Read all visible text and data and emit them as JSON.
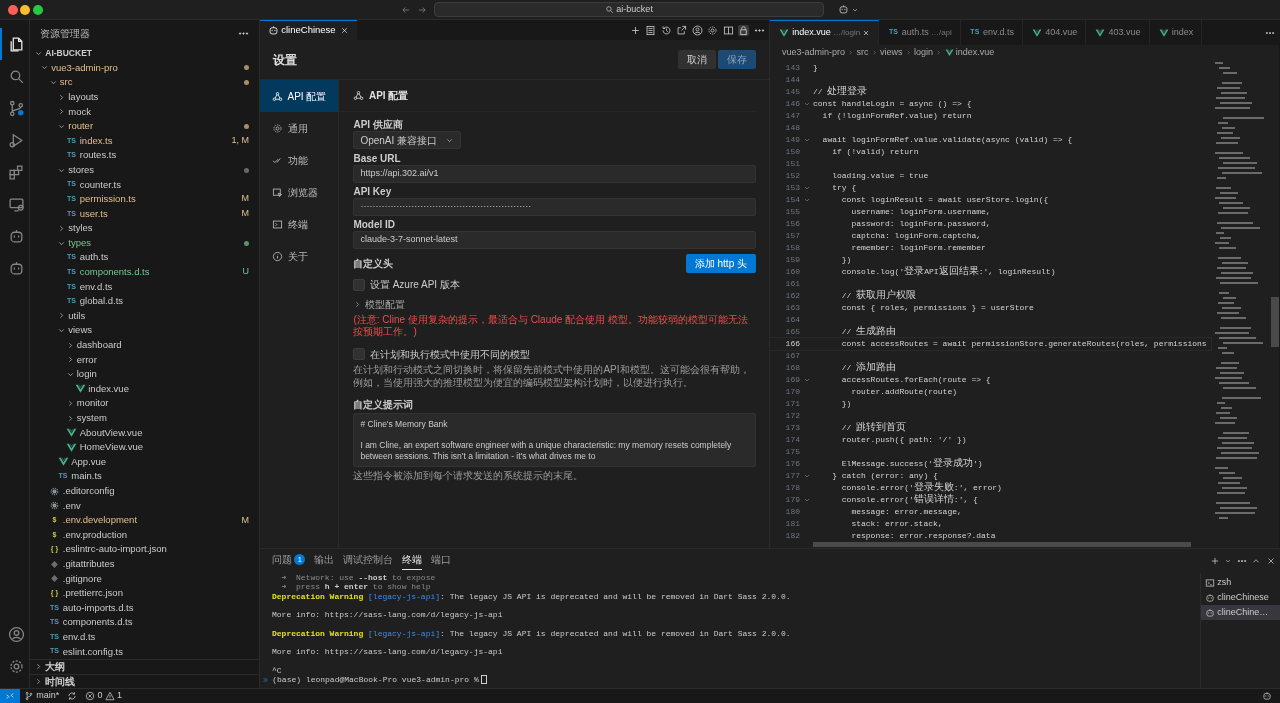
{
  "title_bar": {
    "search": "ai-bucket"
  },
  "activity_bar": [
    {
      "kind": "files",
      "selected": true
    },
    {
      "kind": "search",
      "selected": false
    },
    {
      "kind": "source-control",
      "selected": false
    },
    {
      "kind": "run",
      "selected": false
    },
    {
      "kind": "extensions",
      "selected": false
    },
    {
      "kind": "remote",
      "selected": false
    },
    {
      "kind": "robot",
      "selected": false
    },
    {
      "kind": "robot",
      "selected": false
    }
  ],
  "activity_bottom": [
    {
      "kind": "account"
    },
    {
      "kind": "gear"
    }
  ],
  "explorer": {
    "title": "资源管理器",
    "root": "AI-BUCKET",
    "tree": [
      {
        "label": "vue3-admin-pro",
        "kind": "folder",
        "expanded": true,
        "modified": true,
        "untracked": false,
        "dot": true,
        "children": [
          {
            "label": "src",
            "kind": "folder",
            "expanded": true,
            "modified": true,
            "untracked": false,
            "dot": true,
            "children": [
              {
                "label": "layouts",
                "kind": "folder",
                "expanded": false,
                "modified": false,
                "untracked": false,
                "dot": false
              },
              {
                "label": "mock",
                "kind": "folder",
                "expanded": false,
                "modified": false,
                "untracked": false,
                "dot": false
              },
              {
                "label": "router",
                "kind": "folder",
                "expanded": true,
                "modified": true,
                "untracked": false,
                "dot": true,
                "children": [
                  {
                    "label": "index.ts",
                    "kind": "ts",
                    "icon_text": "TS",
                    "modified": true,
                    "untracked": false,
                    "badge": "1, M"
                  },
                  {
                    "label": "routes.ts",
                    "kind": "ts",
                    "icon_text": "TS",
                    "modified": false,
                    "untracked": false
                  }
                ]
              },
              {
                "label": "stores",
                "kind": "folder",
                "expanded": true,
                "modified": false,
                "untracked": false,
                "dot": true,
                "children": [
                  {
                    "label": "counter.ts",
                    "kind": "ts",
                    "icon_text": "TS",
                    "modified": false,
                    "untracked": false
                  },
                  {
                    "label": "permission.ts",
                    "kind": "ts",
                    "icon_text": "TS",
                    "modified": true,
                    "untracked": false,
                    "badge": "M"
                  },
                  {
                    "label": "user.ts",
                    "kind": "ts",
                    "icon_text": "TS",
                    "modified": true,
                    "untracked": false,
                    "badge": "M"
                  }
                ]
              },
              {
                "label": "styles",
                "kind": "folder",
                "expanded": false,
                "modified": false,
                "untracked": false,
                "dot": false
              },
              {
                "label": "types",
                "kind": "folder",
                "expanded": true,
                "modified": false,
                "untracked": true,
                "dot": true,
                "children": [
                  {
                    "label": "auth.ts",
                    "kind": "ts",
                    "icon_text": "TS",
                    "modified": false,
                    "untracked": false
                  },
                  {
                    "label": "components.d.ts",
                    "kind": "ts",
                    "icon_text": "TS",
                    "modified": false,
                    "untracked": true,
                    "badge": "U"
                  },
                  {
                    "label": "env.d.ts",
                    "kind": "ts",
                    "icon_text": "TS",
                    "modified": false,
                    "untracked": false
                  },
                  {
                    "label": "global.d.ts",
                    "kind": "ts",
                    "icon_text": "TS",
                    "modified": false,
                    "untracked": false
                  }
                ]
              },
              {
                "label": "utils",
                "kind": "folder",
                "expanded": false,
                "modified": false,
                "untracked": false,
                "dot": false
              },
              {
                "label": "views",
                "kind": "folder",
                "expanded": true,
                "modified": false,
                "untracked": false,
                "dot": false,
                "children": [
                  {
                    "label": "dashboard",
                    "kind": "folder",
                    "expanded": false,
                    "modified": false,
                    "untracked": false,
                    "dot": false
                  },
                  {
                    "label": "error",
                    "kind": "folder",
                    "expanded": false,
                    "modified": false,
                    "untracked": false,
                    "dot": false
                  },
                  {
                    "label": "login",
                    "kind": "folder",
                    "expanded": true,
                    "modified": false,
                    "untracked": false,
                    "dot": false,
                    "children": [
                      {
                        "label": "index.vue",
                        "kind": "vue",
                        "modified": false,
                        "untracked": false
                      }
                    ]
                  },
                  {
                    "label": "monitor",
                    "kind": "folder",
                    "expanded": false,
                    "modified": false,
                    "untracked": false,
                    "dot": false
                  },
                  {
                    "label": "system",
                    "kind": "folder",
                    "expanded": false,
                    "modified": false,
                    "untracked": false,
                    "dot": false
                  },
                  {
                    "label": "AboutView.vue",
                    "kind": "vue",
                    "modified": false,
                    "untracked": false
                  },
                  {
                    "label": "HomeView.vue",
                    "kind": "vue",
                    "modified": false,
                    "untracked": false
                  }
                ]
              },
              {
                "label": "App.vue",
                "kind": "vue",
                "modified": false,
                "untracked": false
              },
              {
                "label": "main.ts",
                "kind": "ts",
                "icon_text": "TS",
                "modified": false,
                "untracked": false
              }
            ]
          },
          {
            "label": ".editorconfig",
            "kind": "config",
            "modified": false,
            "untracked": false
          },
          {
            "label": ".env",
            "kind": "config",
            "modified": false,
            "untracked": false
          },
          {
            "label": ".env.development",
            "kind": "env",
            "icon_text": "$",
            "modified": true,
            "untracked": false,
            "badge": "M"
          },
          {
            "label": ".env.production",
            "kind": "env",
            "icon_text": "$",
            "modified": false,
            "untracked": false
          },
          {
            "label": ".eslintrc-auto-import.json",
            "kind": "json",
            "icon_text": "{ }",
            "modified": false,
            "untracked": false
          },
          {
            "label": ".gitattributes",
            "kind": "git",
            "modified": false,
            "untracked": false
          },
          {
            "label": ".gitignore",
            "kind": "git",
            "modified": false,
            "untracked": false
          },
          {
            "label": ".prettierrc.json",
            "kind": "json",
            "icon_text": "{ }",
            "modified": false,
            "untracked": false
          },
          {
            "label": "auto-imports.d.ts",
            "kind": "ts",
            "icon_text": "TS",
            "modified": false,
            "untracked": false
          },
          {
            "label": "components.d.ts",
            "kind": "ts",
            "icon_text": "TS",
            "modified": false,
            "untracked": false
          },
          {
            "label": "env.d.ts",
            "kind": "ts",
            "icon_text": "TS",
            "modified": false,
            "untracked": false
          },
          {
            "label": "eslint.config.ts",
            "kind": "ts",
            "icon_text": "TS",
            "modified": false,
            "untracked": false
          }
        ]
      }
    ],
    "sections": [
      {
        "label": "大纲",
        "expanded": false
      },
      {
        "label": "时间线",
        "expanded": false
      }
    ]
  },
  "cline": {
    "tab": "clineChinese",
    "title": "设置",
    "buttons": [
      {
        "label": "取消",
        "kind": "secondary"
      },
      {
        "label": "保存",
        "kind": "primary",
        "disabled": true
      }
    ],
    "nav": [
      {
        "label": "API 配置",
        "kind": "api",
        "selected": true
      },
      {
        "label": "通用",
        "kind": "gear",
        "selected": false
      },
      {
        "label": "功能",
        "kind": "check",
        "selected": false
      },
      {
        "label": "浏览器",
        "kind": "browser",
        "selected": false
      },
      {
        "label": "终端",
        "kind": "terminal",
        "selected": false
      },
      {
        "label": "关于",
        "kind": "info",
        "selected": false
      }
    ],
    "heading": "API 配置",
    "fields": [
      {
        "label": "API 供应商",
        "kind": "select",
        "value": "OpenAI 兼容接口"
      },
      {
        "label": "Base URL",
        "kind": "text",
        "value": "https://api.302.ai/v1"
      },
      {
        "label": "API Key",
        "kind": "text",
        "value": "·························································"
      },
      {
        "label": "Model ID",
        "kind": "text",
        "value": "claude-3-7-sonnet-latest"
      }
    ],
    "custom_headers": {
      "label": "自定义头",
      "button": "添加 http 头"
    },
    "azure": {
      "label": "设置 Azure API 版本",
      "checked": false
    },
    "model_config": {
      "label": "模型配置",
      "expanded": false
    },
    "warning": "(注意: Cline 使用复杂的提示，最适合与 Claude 配合使用 模型。功能较弱的模型可能无法按预期工作。)",
    "different_models": {
      "label": "在计划和执行模式中使用不同的模型",
      "checked": false,
      "description": "在计划和行动模式之间切换时，将保留先前模式中使用的API和模型。这可能会很有帮助，例如，当使用强大的推理模型为便宜的编码模型架构计划时，以便进行执行。"
    },
    "custom_prompt": {
      "label": "自定义提示词",
      "lines": [
        "# Cline's Memory Bank",
        "I am Cline, an expert software engineer with a unique characteristic: my memory resets completely between sessions. This isn't a limitation - it's what drives me to"
      ],
      "hint": "这些指令被添加到每个请求发送的系统提示的末尾。"
    }
  },
  "editor": {
    "tabs": [
      {
        "label": "index.vue",
        "description": "…/login",
        "kind": "vue",
        "selected": true
      },
      {
        "label": "auth.ts",
        "description": "…/api",
        "kind": "ts",
        "icon_text": "TS",
        "selected": false
      },
      {
        "label": "env.d.ts",
        "kind": "ts",
        "icon_text": "TS",
        "selected": false
      },
      {
        "label": "404.vue",
        "kind": "vue",
        "selected": false
      },
      {
        "label": "403.vue",
        "kind": "vue",
        "selected": false
      },
      {
        "label": "index",
        "kind": "vue",
        "selected": false
      }
    ],
    "breadcrumb": [
      {
        "label": "vue3-admin-pro",
        "kind": "folder"
      },
      {
        "label": "src",
        "kind": "folder"
      },
      {
        "label": "views",
        "kind": "folder"
      },
      {
        "label": "login",
        "kind": "folder"
      },
      {
        "label": "index.vue",
        "kind": "vue"
      }
    ],
    "lines": [
      {
        "n": "143",
        "text": "}",
        "fold": false,
        "current": false
      },
      {
        "n": "144",
        "fold": false,
        "current": false
      },
      {
        "n": "145",
        "text": "// 处理登录",
        "fold": false,
        "current": false
      },
      {
        "n": "146",
        "text": "const handleLogin = async () => {",
        "fold": true,
        "current": false
      },
      {
        "n": "147",
        "text": "  if (!loginFormRef.value) return",
        "fold": false,
        "current": false
      },
      {
        "n": "148",
        "fold": false,
        "current": false
      },
      {
        "n": "149",
        "text": "  await loginFormRef.value.validate(async (valid) => {",
        "fold": true,
        "current": false
      },
      {
        "n": "150",
        "text": "    if (!valid) return",
        "fold": false,
        "current": false
      },
      {
        "n": "151",
        "fold": false,
        "current": false
      },
      {
        "n": "152",
        "text": "    loading.value = true",
        "fold": false,
        "current": false
      },
      {
        "n": "153",
        "text": "    try {",
        "fold": true,
        "current": false
      },
      {
        "n": "154",
        "text": "      const loginResult = await userStore.login({",
        "fold": true,
        "current": false
      },
      {
        "n": "155",
        "text": "        username: loginForm.username,",
        "fold": false,
        "current": false
      },
      {
        "n": "156",
        "text": "        password: loginForm.password,",
        "fold": false,
        "current": false
      },
      {
        "n": "157",
        "text": "        captcha: loginForm.captcha,",
        "fold": false,
        "current": false
      },
      {
        "n": "158",
        "text": "        remember: loginForm.remember",
        "fold": false,
        "current": false
      },
      {
        "n": "159",
        "text": "      })",
        "fold": false,
        "current": false
      },
      {
        "n": "160",
        "text": "      console.log('登录API返回结果:', loginResult)",
        "fold": false,
        "current": false
      },
      {
        "n": "161",
        "fold": false,
        "current": false
      },
      {
        "n": "162",
        "text": "      // 获取用户权限",
        "fold": false,
        "current": false
      },
      {
        "n": "163",
        "text": "      const { roles, permissions } = userStore",
        "fold": false,
        "current": false
      },
      {
        "n": "164",
        "fold": false,
        "current": false
      },
      {
        "n": "165",
        "text": "      // 生成路由",
        "fold": false,
        "current": false
      },
      {
        "n": "166",
        "text": "      const accessRoutes = await permissionStore.generateRoutes(roles, permissions",
        "fold": false,
        "current": true
      },
      {
        "n": "167",
        "fold": false,
        "current": false
      },
      {
        "n": "168",
        "text": "      // 添加路由",
        "fold": false,
        "current": false
      },
      {
        "n": "169",
        "text": "      accessRoutes.forEach(route => {",
        "fold": true,
        "current": false
      },
      {
        "n": "170",
        "text": "        router.addRoute(route)",
        "fold": false,
        "current": false
      },
      {
        "n": "171",
        "text": "      })",
        "fold": false,
        "current": false
      },
      {
        "n": "172",
        "fold": false,
        "current": false
      },
      {
        "n": "173",
        "text": "      // 跳转到首页",
        "fold": false,
        "current": false
      },
      {
        "n": "174",
        "text": "      router.push({ path: '/' })",
        "fold": false,
        "current": false
      },
      {
        "n": "175",
        "fold": false,
        "current": false
      },
      {
        "n": "176",
        "text": "      ElMessage.success('登录成功')",
        "fold": false,
        "current": false
      },
      {
        "n": "177",
        "text": "    } catch (error: any) {",
        "fold": true,
        "current": false
      },
      {
        "n": "178",
        "text": "      console.error('登录失败:', error)",
        "fold": false,
        "current": false
      },
      {
        "n": "179",
        "text": "      console.error('错误详情:', {",
        "fold": true,
        "current": false
      },
      {
        "n": "180",
        "text": "        message: error.message,",
        "fold": false,
        "current": false
      },
      {
        "n": "181",
        "text": "        stack: error.stack,",
        "fold": false,
        "current": false
      },
      {
        "n": "182",
        "text": "        response: error.response?.data",
        "fold": false,
        "current": false
      }
    ]
  },
  "panel": {
    "tabs": [
      {
        "label": "问题",
        "badge": "1",
        "selected": false
      },
      {
        "label": "输出",
        "selected": false
      },
      {
        "label": "调试控制台",
        "selected": false
      },
      {
        "label": "终端",
        "selected": true
      },
      {
        "label": "端口",
        "selected": false
      }
    ],
    "terminal": [
      {
        "kind": "hint",
        "text": "  ➜  Network: use **--host** to expose"
      },
      {
        "kind": "hint",
        "text": "  ➜  press **h + enter** to show help"
      },
      {
        "kind": "warning",
        "label": "Deprecation Warning",
        "tag": "[legacy-js-api]",
        "text": ": The legacy JS API is deprecated and will be removed in Dart Sass 2.0.0."
      },
      {
        "kind": "blank"
      },
      {
        "kind": "plain",
        "text": "More info: https://sass-lang.com/d/legacy-js-api"
      },
      {
        "kind": "blank"
      },
      {
        "kind": "warning",
        "label": "Deprecation Warning",
        "tag": "[legacy-js-api]",
        "text": ": The legacy JS API is deprecated and will be removed in Dart Sass 2.0.0."
      },
      {
        "kind": "blank"
      },
      {
        "kind": "plain",
        "text": "More info: https://sass-lang.com/d/legacy-js-api"
      },
      {
        "kind": "blank"
      },
      {
        "kind": "plain",
        "text": "^C"
      },
      {
        "kind": "prompt",
        "text": "(base) leonpad@MacBook-Pro vue3-admin-pro %"
      }
    ],
    "sessions": [
      {
        "label": "zsh",
        "kind": "shell",
        "selected": false
      },
      {
        "label": "clineChinese",
        "kind": "robot",
        "selected": false
      },
      {
        "label": "clineChine…",
        "kind": "robot",
        "selected": true
      }
    ]
  },
  "status_bar": {
    "branch": "main*",
    "errors": "0",
    "warnings": "1"
  }
}
